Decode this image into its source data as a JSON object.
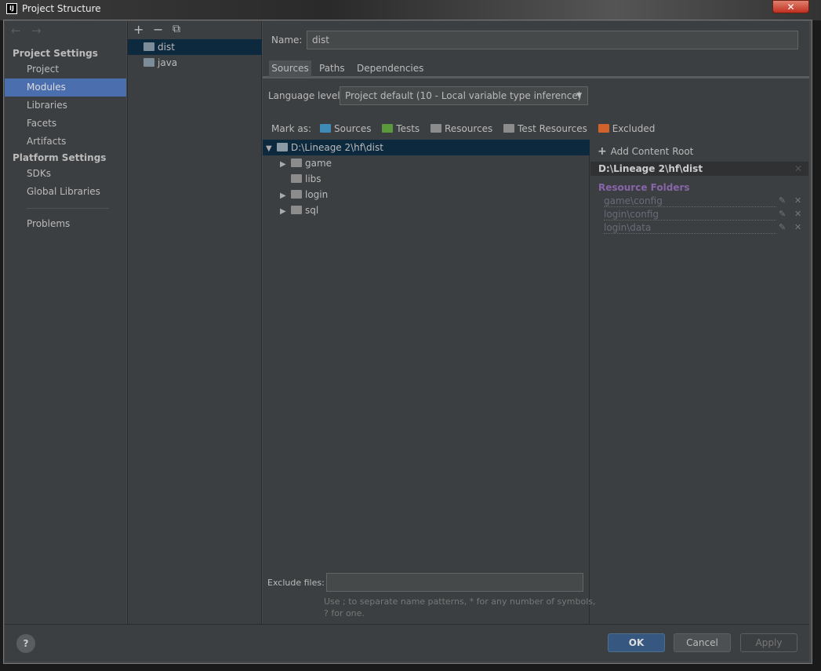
{
  "window": {
    "title": "Project Structure",
    "close": "✕",
    "logo": "IJ"
  },
  "nav": {
    "back": "←",
    "forward": "→"
  },
  "sidebar": {
    "project_settings": "Project Settings",
    "platform_settings": "Platform Settings",
    "items": [
      {
        "label": "Project"
      },
      {
        "label": "Modules",
        "selected": true
      },
      {
        "label": "Libraries"
      },
      {
        "label": "Facets"
      },
      {
        "label": "Artifacts"
      }
    ],
    "platform_items": [
      {
        "label": "SDKs"
      },
      {
        "label": "Global Libraries"
      }
    ],
    "problems": "Problems"
  },
  "modules": {
    "toolbar": {
      "add": "+",
      "remove": "−",
      "copy": "⧉"
    },
    "items": [
      {
        "label": "dist",
        "selected": true
      },
      {
        "label": "java"
      }
    ]
  },
  "main": {
    "name_label": "Name:",
    "name_value": "dist",
    "tabs": [
      {
        "label": "Sources",
        "active": true
      },
      {
        "label": "Paths"
      },
      {
        "label": "Dependencies"
      }
    ],
    "language_level_label": "Language level:",
    "language_level_value": "Project default (10 - Local variable type inference)",
    "mark_as_label": "Mark as:",
    "mark_as": [
      {
        "label": "Sources",
        "color": "#3f8bb5"
      },
      {
        "label": "Tests",
        "color": "#5a9a3c"
      },
      {
        "label": "Resources",
        "color": "#8c8c8c"
      },
      {
        "label": "Test Resources",
        "color": "#8c8c8c"
      },
      {
        "label": "Excluded",
        "color": "#d0632c"
      }
    ],
    "tree": {
      "root": "D:\\Lineage 2\\hf\\dist",
      "children": [
        {
          "label": "game",
          "expandable": true
        },
        {
          "label": "libs",
          "expandable": false
        },
        {
          "label": "login",
          "expandable": true
        },
        {
          "label": "sql",
          "expandable": true
        }
      ]
    },
    "exclude_label": "Exclude files:",
    "exclude_value": "",
    "exclude_hint1": "Use ; to separate name patterns, * for any number of symbols,",
    "exclude_hint2": "? for one."
  },
  "content_root": {
    "add_label": "Add Content Root",
    "root": "D:\\Lineage 2\\hf\\dist",
    "resource_header": "Resource Folders",
    "resource_color": "#9b6fc2",
    "folders": [
      "game\\config",
      "login\\config",
      "login\\data"
    ]
  },
  "footer": {
    "help": "?",
    "ok": "OK",
    "cancel": "Cancel",
    "apply": "Apply"
  }
}
